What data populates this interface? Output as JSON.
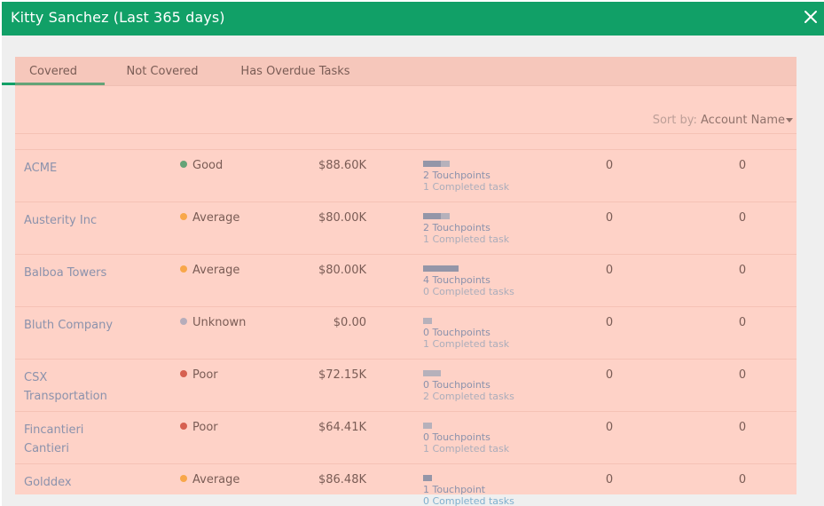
{
  "header": {
    "title": "Kitty Sanchez (Last 365 days)"
  },
  "tabs": [
    {
      "label": "Covered"
    },
    {
      "label": "Not Covered"
    },
    {
      "label": "Has Overdue Tasks"
    }
  ],
  "sort": {
    "label": "Sort by:",
    "value": "Account Name"
  },
  "colors": {
    "brand": "#11a067",
    "link": "#4e86b8",
    "good": "#11a067",
    "average": "#f5a623",
    "unknown": "#8fb0cf",
    "poor": "#c0392b"
  },
  "rows": [
    {
      "account": "ACME",
      "health": "Good",
      "amount": "$88.60K",
      "touchpoints": "2 Touchpoints",
      "tasks": "1 Completed task",
      "col4": "0",
      "col5": "0"
    },
    {
      "account": "Austerity Inc",
      "health": "Average",
      "amount": "$80.00K",
      "touchpoints": "2 Touchpoints",
      "tasks": "1 Completed task",
      "col4": "0",
      "col5": "0"
    },
    {
      "account": "Balboa Towers",
      "health": "Average",
      "amount": "$80.00K",
      "touchpoints": "4 Touchpoints",
      "tasks": "0 Completed tasks",
      "col4": "0",
      "col5": "0"
    },
    {
      "account": "Bluth Company",
      "health": "Unknown",
      "amount": "$0.00",
      "touchpoints": "0 Touchpoints",
      "tasks": "1 Completed task",
      "col4": "0",
      "col5": "0"
    },
    {
      "account": "CSX Transportation",
      "health": "Poor",
      "amount": "$72.15K",
      "touchpoints": "0 Touchpoints",
      "tasks": "2 Completed tasks",
      "col4": "0",
      "col5": "0"
    },
    {
      "account": "Fincantieri Cantieri",
      "health": "Poor",
      "amount": "$64.41K",
      "touchpoints": "0 Touchpoints",
      "tasks": "1 Completed task",
      "col4": "0",
      "col5": "0"
    },
    {
      "account": "Golddex",
      "health": "Average",
      "amount": "$86.48K",
      "touchpoints": "1 Touchpoint",
      "tasks": "0 Completed tasks",
      "col4": "0",
      "col5": "0"
    }
  ]
}
